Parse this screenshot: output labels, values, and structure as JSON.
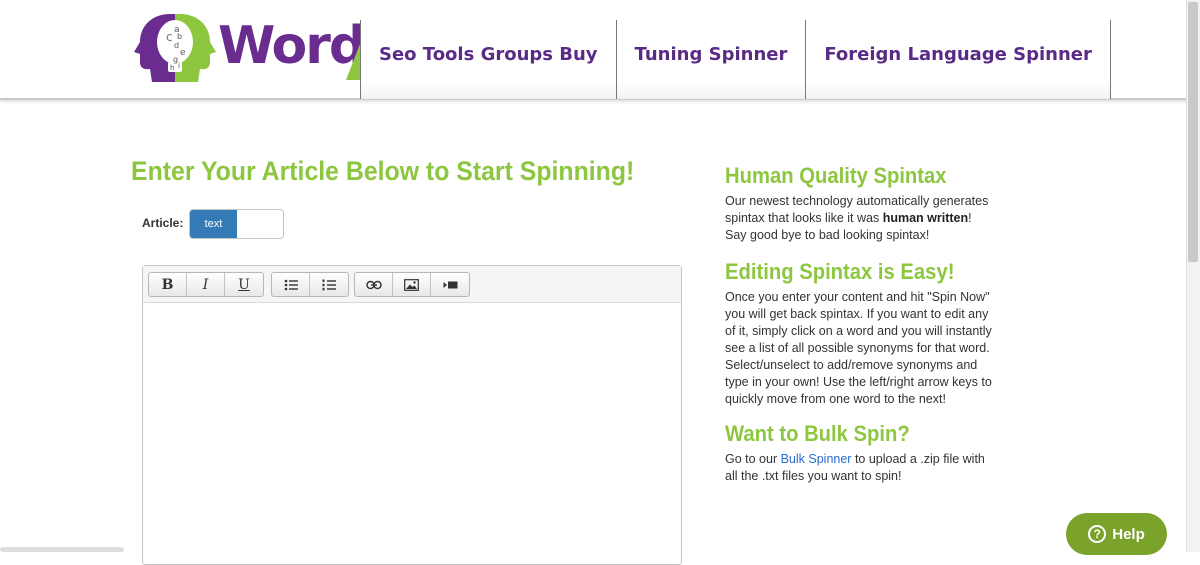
{
  "brand": {
    "logo_text": "Word",
    "logo_letters": "abcdefghi",
    "colors": {
      "purple": "#6a2c8e",
      "green": "#8dc63f"
    }
  },
  "nav": {
    "items": [
      {
        "label": "Seo Tools Groups Buy"
      },
      {
        "label": "Tuning Spinner"
      },
      {
        "label": "Foreign Language Spinner"
      }
    ]
  },
  "main": {
    "title": "Enter Your Article Below to Start Spinning!",
    "article_label": "Article:",
    "toggle": {
      "active": "text"
    }
  },
  "editor": {
    "toolbar": {
      "bold": "B",
      "italic": "I",
      "underline": "U",
      "icons": [
        "bulleted-list-icon",
        "numbered-list-icon",
        "link-icon",
        "image-icon",
        "video-icon"
      ]
    },
    "content": ""
  },
  "side": {
    "h1": "Human Quality Spintax",
    "p1_a": "Our newest technology automatically generates spintax that looks like it was ",
    "p1_b": "human written",
    "p1_c": "! Say good bye to bad looking spintax!",
    "h2": "Editing Spintax is Easy!",
    "p2": "Once you enter your content and hit \"Spin Now\" you will get back spintax. If you want to edit any of it, simply click on a word and you will instantly see a list of all possible synonyms for that word. Select/unselect to add/remove synonyms and type in your own! Use the left/right arrow keys to quickly move from one word to the next!",
    "h3": "Want to Bulk Spin?",
    "p3_a": "Go to our ",
    "p3_link": "Bulk Spinner",
    "p3_b": " to upload a .zip file with all the .txt files you want to spin!"
  },
  "help": {
    "label": "Help",
    "icon_text": "?"
  }
}
